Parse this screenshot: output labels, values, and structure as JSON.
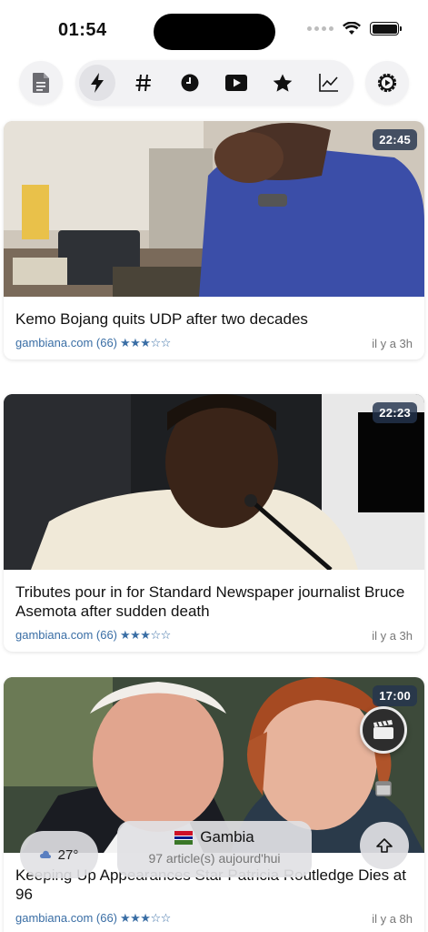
{
  "status_bar": {
    "time": "01:54"
  },
  "toolbar": {
    "items": [
      {
        "name": "document",
        "active": false
      },
      {
        "name": "flash",
        "active": true
      },
      {
        "name": "hashtag",
        "active": false
      },
      {
        "name": "clock",
        "active": false
      },
      {
        "name": "video",
        "active": false
      },
      {
        "name": "star",
        "active": false
      },
      {
        "name": "chart",
        "active": false
      },
      {
        "name": "settings",
        "active": false
      }
    ]
  },
  "articles": [
    {
      "title": "Kemo Bojang quits UDP after two decades",
      "time": "22:45",
      "source": "gambiana.com (66)",
      "rating": "★★★☆☆",
      "ago": "il y a 3h"
    },
    {
      "title": "Tributes pour in for Standard Newspaper journalist Bruce Asemota after sudden death",
      "time": "22:23",
      "source": "gambiana.com (66)",
      "rating": "★★★☆☆",
      "ago": "il y a 3h"
    },
    {
      "title": "Keeping Up Appearances Star Patricia Routledge Dies at 96",
      "time": "17:00",
      "source": "gambiana.com (66)",
      "rating": "★★★☆☆",
      "ago": "il y a 8h"
    }
  ],
  "weather": {
    "temperature": "27°",
    "icon": "cloud-icon"
  },
  "country": {
    "flag": "gambia-flag",
    "name": "Gambia",
    "count": "97 article(s) aujourd'hui"
  },
  "colors": {
    "accent": "#3a6ea5",
    "badge": "#24344e"
  }
}
